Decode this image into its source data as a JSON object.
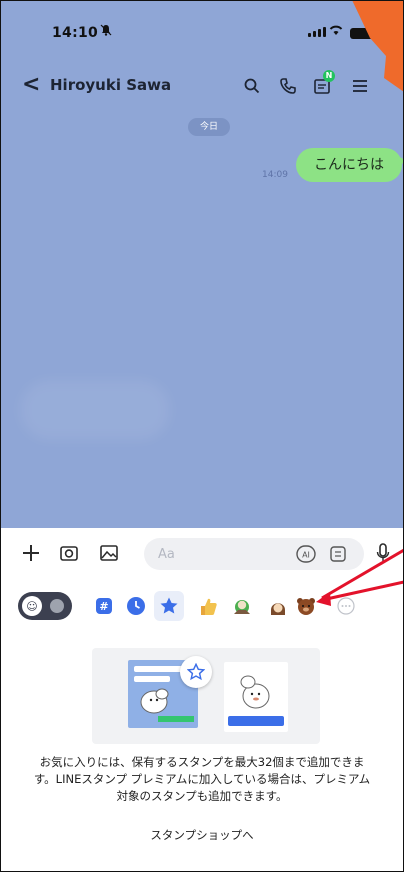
{
  "status_bar": {
    "time": "14:10"
  },
  "header": {
    "back_label": "<",
    "contact_name": "Hiroyuki Sawa",
    "notes_badge": "N",
    "icons": [
      "search-icon",
      "phone-icon",
      "notes-icon",
      "menu-icon"
    ]
  },
  "chat": {
    "date_label": "今日",
    "messages": [
      {
        "text": "こんにちは",
        "time": "14:09",
        "sender": "me"
      }
    ]
  },
  "input_bar": {
    "placeholder": "Aa",
    "ai_label": "AI",
    "icons": [
      "plus-icon",
      "camera-icon",
      "image-icon",
      "ai-icon",
      "sticker-icon",
      "mic-icon"
    ]
  },
  "sticker_tabs": {
    "items": [
      "emoji-toggle",
      "hash-tab",
      "recent-tab",
      "favorites-tab",
      "thumbs-up-sticker",
      "sticker-pack-1",
      "sticker-pack-2",
      "bear-sticker",
      "more-tab"
    ],
    "selected": "favorites-tab"
  },
  "favorites_panel": {
    "description": "お気に入りには、保有するスタンプを最大32個まで追加できます。LINEスタンプ プレミアムに加入している場合は、プレミアム対象のスタンプも追加できます。",
    "shop_button": "スタンプショップへ"
  },
  "colors": {
    "chat_bg": "#8fa6d6",
    "bubble_green": "#8de285",
    "accent_blue": "#3b6ee8",
    "annotation_red": "#e3122b",
    "annotation_orange": "#ef6a2b"
  }
}
